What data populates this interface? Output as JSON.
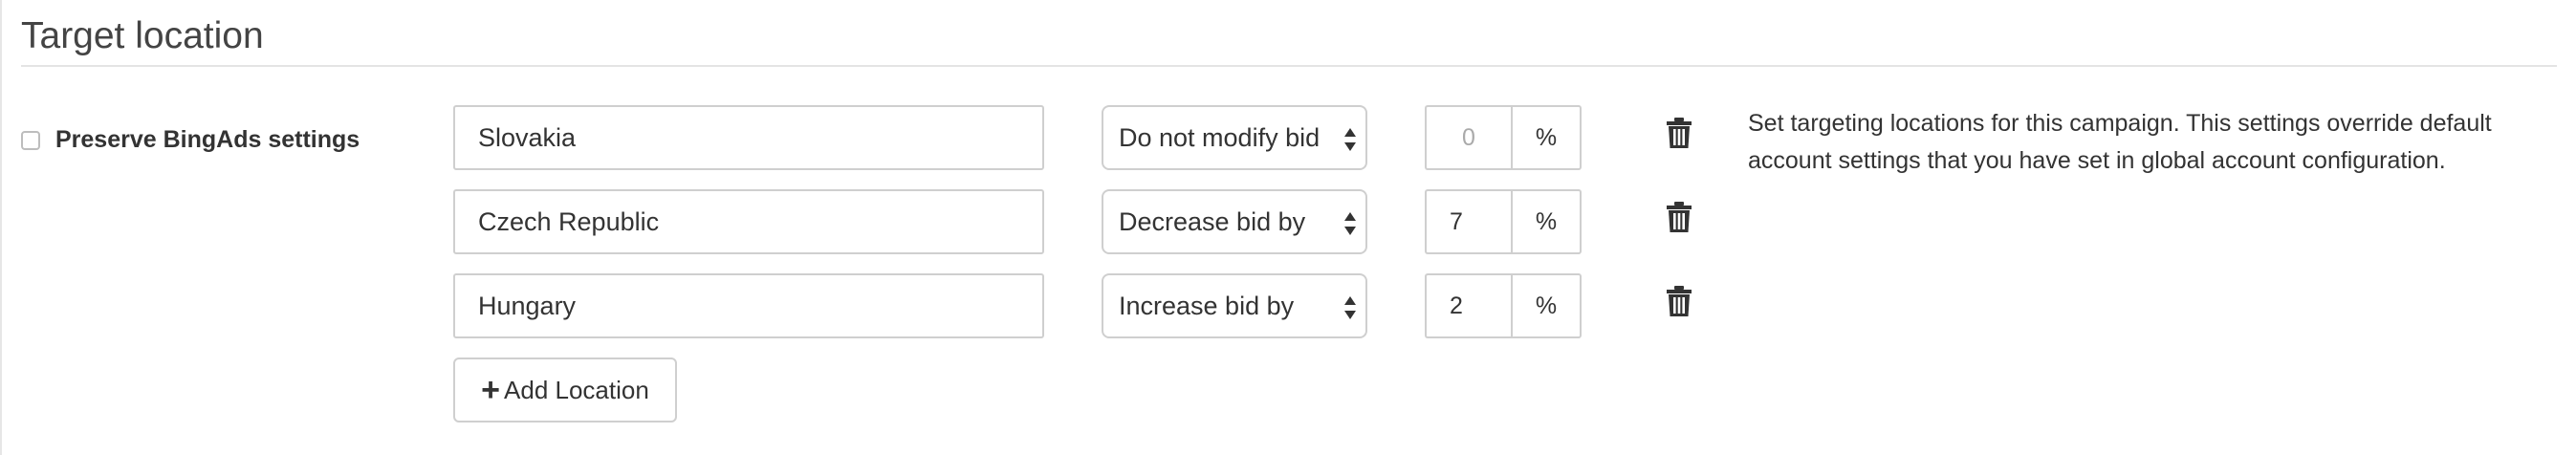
{
  "section": {
    "title": "Target location"
  },
  "preserve": {
    "label": "Preserve BingAds settings",
    "checked": false
  },
  "locations": [
    {
      "name": "Slovakia",
      "bid_mode": "Do not modify bid",
      "value": "",
      "placeholder": "0",
      "unit": "%"
    },
    {
      "name": "Czech Republic",
      "bid_mode": "Decrease bid by",
      "value": "7",
      "placeholder": "",
      "unit": "%"
    },
    {
      "name": "Hungary",
      "bid_mode": "Increase bid by",
      "value": "2",
      "placeholder": "",
      "unit": "%"
    }
  ],
  "add_button": {
    "label": "Add Location",
    "icon": "plus-icon"
  },
  "help_text": "Set targeting locations for this campaign. This settings override default account settings that you have set in global account configuration.",
  "icons": {
    "delete": "trash-icon",
    "select_arrows": "sort-arrows-icon"
  }
}
